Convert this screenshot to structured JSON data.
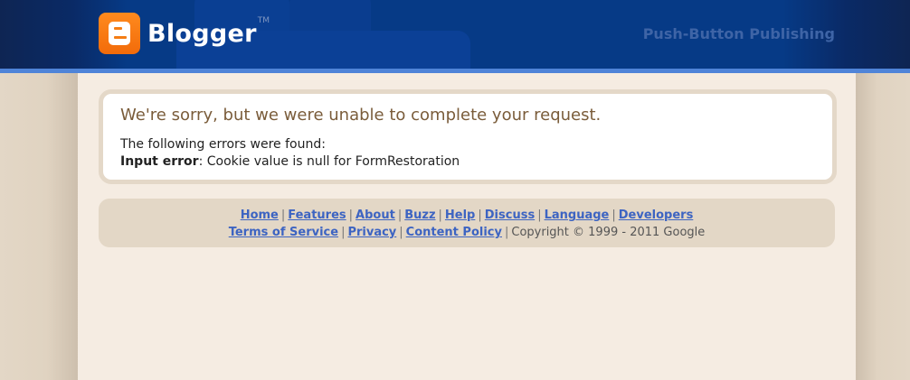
{
  "header": {
    "brand": "Blogger",
    "trademark": "TM",
    "tagline": "Push-Button Publishing",
    "colors": {
      "bar": "#063a86",
      "stripe": "#4f84d8",
      "logo": "#f47d14"
    },
    "logo_icon": "blogger-b-icon"
  },
  "error": {
    "title": "We're sorry, but we were unable to complete your request.",
    "intro": "The following errors were found:",
    "label": "Input error",
    "message": ": Cookie value is null for FormRestoration"
  },
  "footer": {
    "links_row1": [
      "Home",
      "Features",
      "About",
      "Buzz",
      "Help",
      "Discuss",
      "Language",
      "Developers"
    ],
    "links_row2": [
      "Terms of Service",
      "Privacy",
      "Content Policy"
    ],
    "separator": "|",
    "copyright": "Copyright © 1999 - 2011 Google"
  }
}
